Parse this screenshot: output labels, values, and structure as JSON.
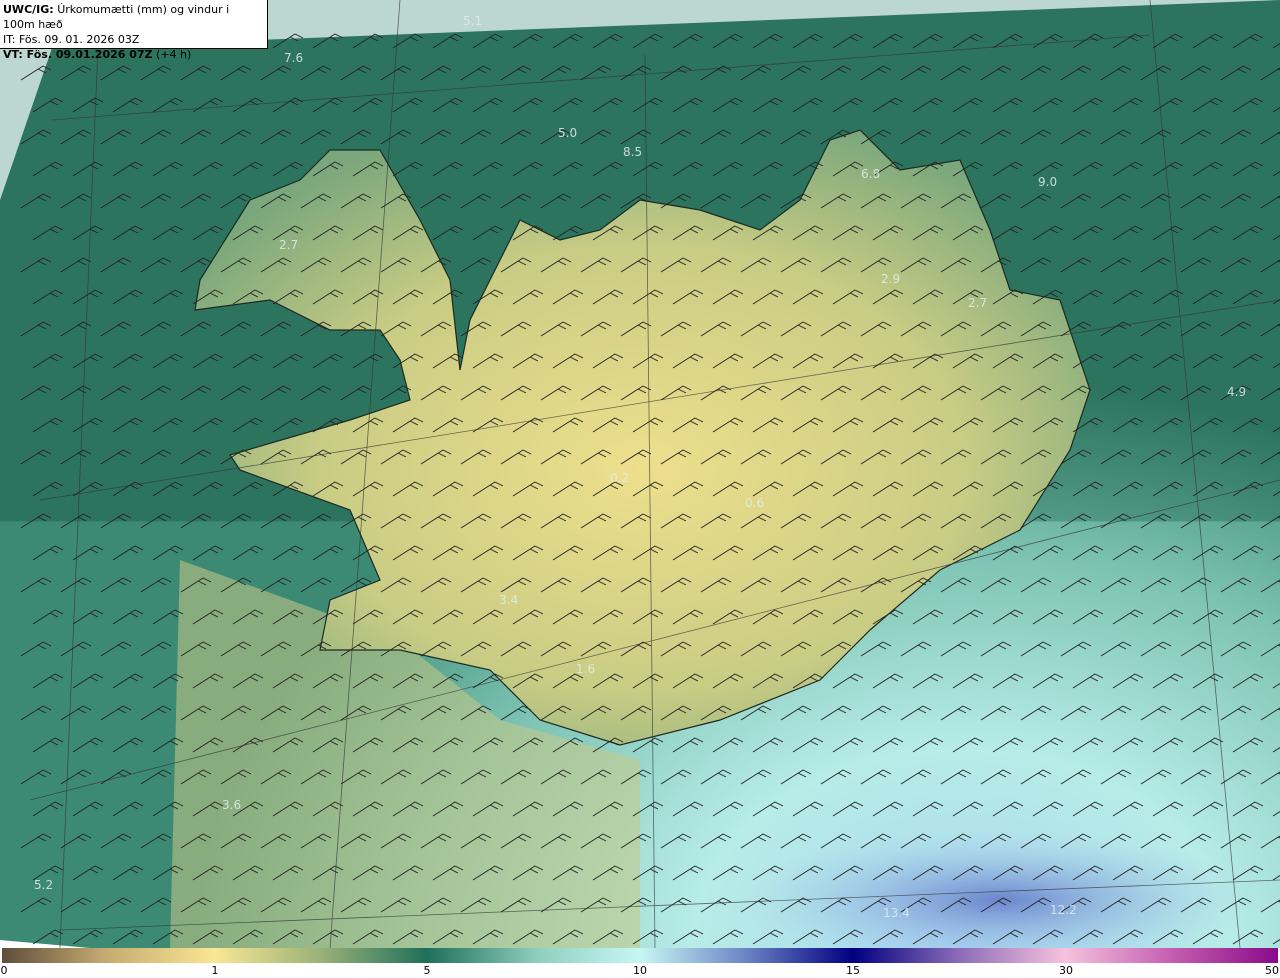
{
  "header": {
    "model_prefix": "UWC/IG:",
    "title": "Úrkomumætti (mm) og vindur i 100m hæð",
    "init_time": "IT: Fös. 09. 01. 2026 03Z",
    "valid_prefix": "VT: Fös. 09.01.2026 07Z",
    "lead": "(+4 h)"
  },
  "map_labels": [
    "5.1",
    "7.6",
    "5.0",
    "8.5",
    "6.8",
    "9.0",
    "2.7",
    "2.9",
    "2.7",
    "4.9",
    "0.2",
    "0.6",
    "3.4",
    "1.6",
    "3.6",
    "5.2",
    "13.4",
    "12.2"
  ],
  "colorbar": {
    "ticks": [
      "0",
      "1",
      "5",
      "10",
      "15",
      "30",
      "50"
    ],
    "colors": [
      "#5e4e3b",
      "#f8e793",
      "#1f6f5a",
      "#c6f7f3",
      "#000080",
      "#f6c2de",
      "#8a0a8a"
    ]
  }
}
